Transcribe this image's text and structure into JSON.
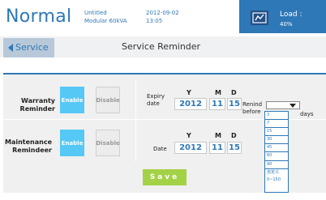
{
  "header": {
    "mode": "Normal",
    "device_name": "Untitled",
    "device_model": "Modular 60kVA",
    "date": "2012-09-02",
    "time": "13:05",
    "load_label": "Load :",
    "load_value": "40%",
    "alarm_icon": "alarm-bell-icon"
  },
  "titlebar": {
    "back_label": "Service",
    "title": "Service Reminder"
  },
  "warranty": {
    "label_line1": "Warranty",
    "label_line2": "Reminder",
    "enable_label": "Enable",
    "disable_label": "Disable",
    "expiry_line1": "Expiry",
    "expiry_line2": "date",
    "col_y": "Y",
    "col_m": "M",
    "col_d": "D",
    "year": "2012",
    "month": "11",
    "day": "15"
  },
  "reminder": {
    "label_line1": "Renind",
    "label_line2": "before",
    "days_label": "days",
    "options": [
      "3",
      "7",
      "15",
      "30",
      "45",
      "60",
      "90",
      "自定义0~150"
    ]
  },
  "maintenance": {
    "label_line1": "Maintenance",
    "label_line2": "Remindeer",
    "enable_label": "Enable",
    "disable_label": "Disable",
    "date_label": "Date",
    "col_y": "Y",
    "col_m": "M",
    "col_d": "D",
    "year": "2012",
    "month": "11",
    "day": "15"
  },
  "save_label": "Save",
  "colors": {
    "accent": "#2e78b7",
    "enable_active": "#56c8f5",
    "save": "#a3d247"
  }
}
